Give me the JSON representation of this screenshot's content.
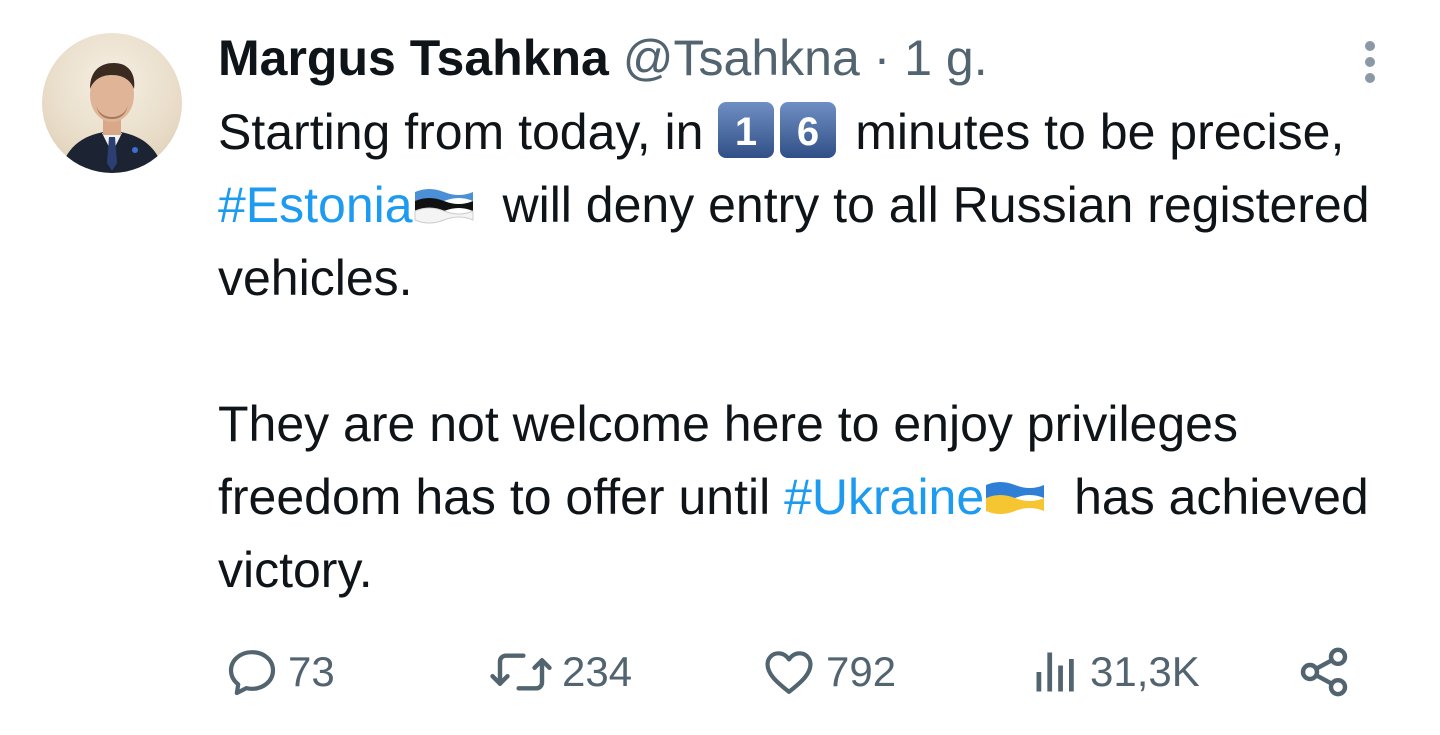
{
  "author": {
    "name": "Margus Tsahkna",
    "handle": "@Tsahkna",
    "separator": "·",
    "time": "1 g."
  },
  "tweet": {
    "p1_a": "Starting from today, in",
    "keycap_digits": [
      "1",
      "6"
    ],
    "p1_b": " minutes to be precise, ",
    "hashtag_estonia": "#Estonia",
    "p1_c": " will deny entry to all Russian registered vehicles.",
    "p2_a": "They are not welcome here to enjoy privileges freedom has to offer until ",
    "hashtag_ukraine": "#Ukraine",
    "p2_b": " has achieved victory."
  },
  "actions": {
    "replies": "73",
    "retweets": "234",
    "likes": "792",
    "views": "31,3K"
  },
  "colors": {
    "text": "#0f1419",
    "muted": "#536471",
    "link": "#1d9bf0"
  }
}
